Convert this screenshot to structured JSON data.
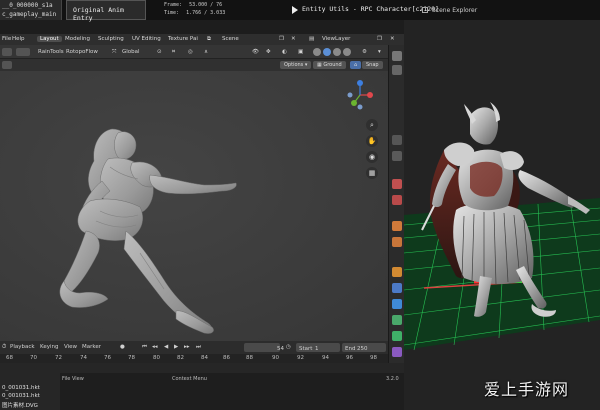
{
  "top_strip": {
    "left_lines": [
      "__0_000000_s1a",
      "c_gameplay_main"
    ],
    "panel_title": "Original Anim Entry",
    "frame_label": "Frame:",
    "frame_value": "53.000 / 76",
    "time_label": "Time:",
    "time_value": "1.766 / 3.033",
    "entity_label": "Entity Utils - RPC Character[c2120]",
    "scene_explorer": "Scene Explorer"
  },
  "menubar": {
    "items": [
      "File",
      "Help"
    ],
    "workspaces": [
      "Layout",
      "Modeling",
      "Sculpting",
      "UV Editing",
      "Texture Pai"
    ],
    "scene": "Scene",
    "view_layer": "ViewLayer"
  },
  "toolbar": {
    "tools": [
      "RainTools",
      "RotopoFlow",
      "Global"
    ]
  },
  "subbar": {
    "options": "Options",
    "ground": "Ground",
    "snap": "Snap"
  },
  "gizmo": {
    "colors": {
      "x": "#e0474c",
      "y": "#6bb530",
      "z": "#3d7fe0",
      "neg": "#7b9ccc"
    }
  },
  "viewport_tools": [
    "zoom-icon",
    "hand-icon",
    "camera-icon",
    "grid-icon"
  ],
  "timeline": {
    "menus": [
      "Playback",
      "Keying",
      "View",
      "Marker"
    ],
    "current_frame": "54",
    "start_label": "Start",
    "start_value": "1",
    "end_label": "End",
    "end_value": "250",
    "ruler": [
      "68",
      "70",
      "72",
      "74",
      "76",
      "78",
      "80",
      "82",
      "84",
      "86",
      "88",
      "90",
      "92",
      "94",
      "96",
      "98"
    ]
  },
  "bottom": {
    "files": [
      "0_001031.hkt",
      "0_001031.hkt",
      "图片素材.DVG"
    ],
    "filelist_header": "File View",
    "context_menu": "Context Menu",
    "version": "3.2.0"
  },
  "watermark": "爱上手游网"
}
